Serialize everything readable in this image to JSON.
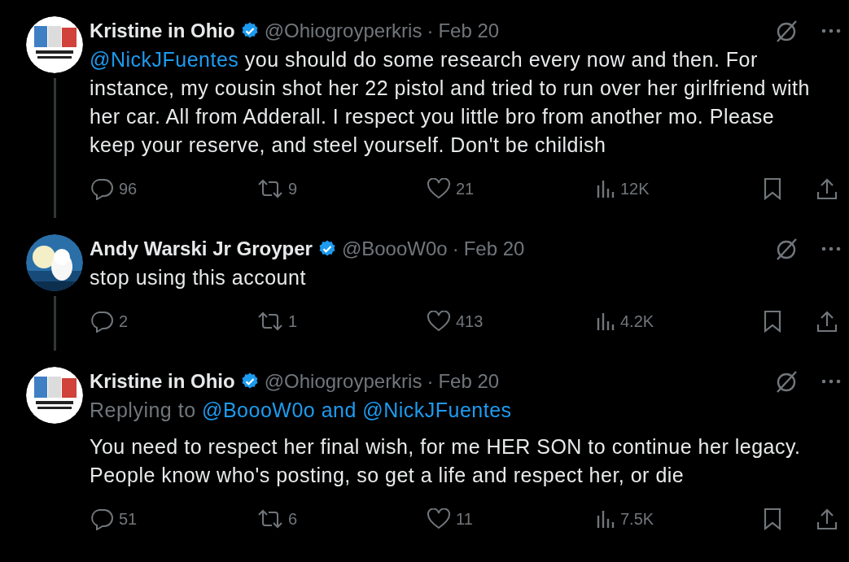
{
  "tweets": [
    {
      "name": "Kristine in Ohio",
      "verified": true,
      "handle": "@Ohiogroyperkris",
      "separator": "·",
      "date": "Feb 20",
      "thread_line": true,
      "mention": "@NickJFuentes",
      "text": "you should do some research every now and then. For instance, my cousin shot her 22 pistol and tried to run over her girlfriend with her car. All from Adderall. I respect you little bro from another mo. Please keep your reserve, and steel yourself. Don't be childish",
      "replies": "96",
      "reposts": "9",
      "likes": "21",
      "views": "12K"
    },
    {
      "name": "Andy Warski Jr Groyper",
      "verified": true,
      "handle": "@BoooW0o",
      "separator": "·",
      "date": "Feb 20",
      "thread_line": true,
      "text": "stop using this account",
      "replies": "2",
      "reposts": "1",
      "likes": "413",
      "views": "4.2K"
    },
    {
      "name": "Kristine in Ohio",
      "verified": true,
      "handle": "@Ohiogroyperkris",
      "separator": "·",
      "date": "Feb 20",
      "thread_line": false,
      "replying_prefix": "Replying to",
      "replying_to": "@BoooW0o and @NickJFuentes",
      "text": "You need to respect her final wish, for me HER SON to continue her legacy. People know who's posting, so get a life and respect her, or die",
      "replies": "51",
      "reposts": "6",
      "likes": "11",
      "views": "7.5K"
    }
  ]
}
